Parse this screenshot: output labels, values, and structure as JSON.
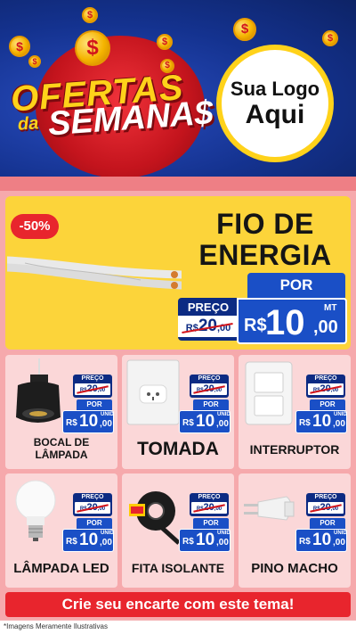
{
  "header": {
    "title_line1": "OFERTAS",
    "title_da": "da",
    "title_line2": "SEMANA$",
    "logo_line1": "Sua Logo",
    "logo_line2": "Aqui",
    "coin_symbol": "$"
  },
  "featured": {
    "discount": "-50%",
    "name": "FIO DE ENERGIA",
    "preco_label": "PREÇO",
    "old_currency": "R$",
    "old_int": "20",
    "old_dec": ",00",
    "por_label": "POR",
    "currency": "R$",
    "price_int": "10",
    "price_dec": ",00",
    "unit": "MT"
  },
  "products": [
    {
      "name": "BOCAL DE LÂMPADA",
      "icon": "lamp-socket-icon",
      "preco_label": "PREÇO",
      "old_currency": "R$",
      "old_int": "20",
      "old_dec": ",00",
      "por_label": "POR",
      "currency": "R$",
      "price_int": "10",
      "price_dec": ",00",
      "unit": "UNID"
    },
    {
      "name": "TOMADA",
      "icon": "outlet-icon",
      "preco_label": "PREÇO",
      "old_currency": "R$",
      "old_int": "20",
      "old_dec": ",00",
      "por_label": "POR",
      "currency": "R$",
      "price_int": "10",
      "price_dec": ",00",
      "unit": "UNID"
    },
    {
      "name": "INTERRUPTOR",
      "icon": "switch-icon",
      "preco_label": "PREÇO",
      "old_currency": "R$",
      "old_int": "20",
      "old_dec": ",00",
      "por_label": "POR",
      "currency": "R$",
      "price_int": "10",
      "price_dec": ",00",
      "unit": "UNID"
    },
    {
      "name": "LÂMPADA LED",
      "icon": "led-bulb-icon",
      "preco_label": "PREÇO",
      "old_currency": "R$",
      "old_int": "20",
      "old_dec": ",00",
      "por_label": "POR",
      "currency": "R$",
      "price_int": "10",
      "price_dec": ",00",
      "unit": "UNID"
    },
    {
      "name": "FITA ISOLANTE",
      "icon": "tape-icon",
      "preco_label": "PREÇO",
      "old_currency": "R$",
      "old_int": "20",
      "old_dec": ",00",
      "por_label": "POR",
      "currency": "R$",
      "price_int": "10",
      "price_dec": ",00",
      "unit": "UNID"
    },
    {
      "name": "PINO MACHO",
      "icon": "plug-icon",
      "preco_label": "PREÇO",
      "old_currency": "R$",
      "old_int": "20",
      "old_dec": ",00",
      "por_label": "POR",
      "currency": "R$",
      "price_int": "10",
      "price_dec": ",00",
      "unit": "UNID"
    }
  ],
  "footer": {
    "cta": "Crie seu encarte com este tema!",
    "disclaimer": "*Imagens Meramente Ilustrativas"
  },
  "colors": {
    "header_blue": "#14328f",
    "red": "#e8252d",
    "yellow": "#fcd43a",
    "price_blue": "#1a4fc6",
    "dark_blue": "#0c2b83",
    "pink_bg": "#f6a9ac"
  }
}
